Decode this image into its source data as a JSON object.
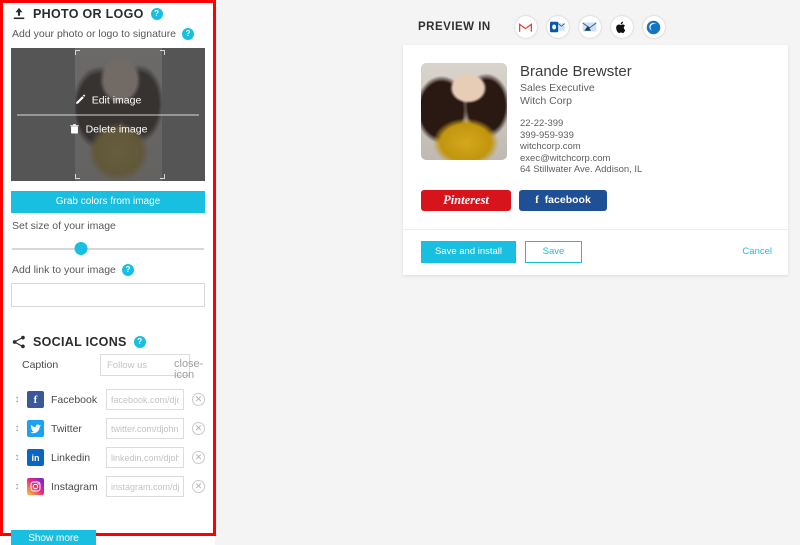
{
  "editor": {
    "photo_section": {
      "icon": "upload-icon",
      "title": "PHOTO OR LOGO",
      "help_badge": "?",
      "subtitle": "Add your photo or logo to signature",
      "subtitle_help_badge": "?",
      "edit_label": "Edit image",
      "edit_icon": "pencil-icon",
      "delete_label": "Delete image",
      "delete_icon": "trash-icon",
      "grab_colors_label": "Grab colors from image",
      "size_label": "Set size of your image",
      "size_value_percent": 36,
      "link_label": "Add link to your image",
      "link_help_badge": "?",
      "link_value": "",
      "link_placeholder": ""
    },
    "social_section": {
      "icon": "share-icon",
      "title": "SOCIAL ICONS",
      "help_badge": "?",
      "caption_label": "Caption",
      "caption_value": "",
      "caption_placeholder": "Follow us",
      "caption_clear_icon": "close-icon",
      "networks": [
        {
          "name": "Facebook",
          "glyph": "f",
          "placeholder": "facebook.com/djc",
          "value": "",
          "color": "#3b5998",
          "class": "fb"
        },
        {
          "name": "Twitter",
          "glyph": "ᵥ",
          "placeholder": "twitter.com/djohns",
          "value": "",
          "color": "#1da1f2",
          "class": "tw"
        },
        {
          "name": "Linkedin",
          "glyph": "in",
          "placeholder": "linkedin.com/djoh",
          "value": "",
          "color": "#0a66c2",
          "class": "li"
        },
        {
          "name": "Instagram",
          "glyph": "◎",
          "placeholder": "instagram.com/dj",
          "value": "",
          "color": "#ee2a7b",
          "class": "ig"
        }
      ],
      "show_more_label": "Show more"
    }
  },
  "preview": {
    "title": "PREVIEW IN",
    "clients": [
      {
        "name": "gmail-icon",
        "label": "M"
      },
      {
        "name": "outlook-icon",
        "label": "O"
      },
      {
        "name": "windows-mail-icon",
        "label": "W"
      },
      {
        "name": "apple-mail-icon",
        "label": "A"
      },
      {
        "name": "thunderbird-icon",
        "label": "T"
      }
    ],
    "signature": {
      "photo": "profile-photo",
      "name": "Brande Brewster",
      "role": "Sales Executive",
      "company": "Witch Corp",
      "contact_lines": [
        "22-22-399",
        "399-959-939",
        "witchcorp.com",
        "exec@witchcorp.com",
        "64 Stillwater Ave. Addison, IL"
      ],
      "social_buttons": [
        {
          "name": "pinterest-button",
          "label": "Pinterest",
          "color": "#d7131c"
        },
        {
          "name": "facebook-button",
          "label": "facebook",
          "color": "#1f4f94"
        }
      ]
    },
    "actions": {
      "save_and_install_label": "Save and install",
      "save_label": "Save",
      "cancel_label": "Cancel"
    }
  },
  "colors": {
    "accent": "#19bfe0",
    "highlight_outline": "#fe0000",
    "page_bg": "#f5f4f5"
  }
}
